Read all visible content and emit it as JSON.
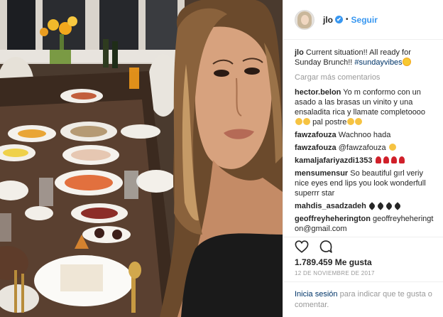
{
  "header": {
    "username": "jlo",
    "verified_badge": "✔",
    "separator": "•",
    "follow_label": "Seguir"
  },
  "caption": {
    "username": "jlo",
    "text": "Current situation!! All ready for Sunday Brunch!!",
    "hashtag": "#sundayvibes"
  },
  "load_more_label": "Cargar más comentarios",
  "comments": [
    {
      "username": "hector.belon",
      "text": "Yo m conformo con un asado a las brasas un vinito y una ensaladita rica y llamate completoooo",
      "tail": "pal postre"
    },
    {
      "username": "fawzafouza",
      "text": "Wachnoo hada"
    },
    {
      "username": "fawzafouza",
      "text": "@fawzafouza"
    },
    {
      "username": "kamaljafariyazdi1353",
      "text": ""
    },
    {
      "username": "mensumensur",
      "text": "So beautiful gırl veriy nice eyes end lips you look wonderfull superrr star"
    },
    {
      "username": "mahdis_asadzadeh",
      "text": ""
    },
    {
      "username": "geoffreyheherington",
      "text": "geoffreyheheringt on@gmail.com"
    },
    {
      "username": "",
      "text": ""
    }
  ],
  "actions": {
    "like_icon": "heart-outline-icon",
    "comment_icon": "speech-bubble-icon"
  },
  "likes_label": "1.789.459 Me gusta",
  "date_label": "12 DE NOVIEMBRE DE 2017",
  "login_bar": {
    "link_label": "Inicia sesión",
    "text": "para indicar que te gusta o comentar."
  },
  "colors": {
    "link_blue": "#3897f0",
    "dark_link": "#003569",
    "muted_text": "#999999",
    "border": "#efefef"
  }
}
